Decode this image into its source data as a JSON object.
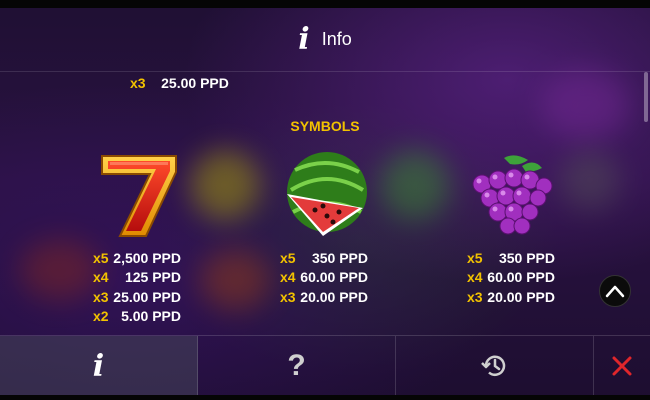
{
  "header": {
    "title": "Info",
    "icon": "info-icon"
  },
  "previous_row": {
    "mult": "x3",
    "value": "25.00 PPD"
  },
  "section_title": "SYMBOLS",
  "symbols": [
    {
      "icon": "seven-icon",
      "pays": [
        {
          "mult": "x5",
          "value": "2,500 PPD"
        },
        {
          "mult": "x4",
          "value": "125 PPD"
        },
        {
          "mult": "x3",
          "value": "25.00 PPD"
        },
        {
          "mult": "x2",
          "value": "5.00 PPD"
        }
      ]
    },
    {
      "icon": "watermelon-icon",
      "pays": [
        {
          "mult": "x5",
          "value": "350 PPD"
        },
        {
          "mult": "x4",
          "value": "60.00 PPD"
        },
        {
          "mult": "x3",
          "value": "20.00 PPD"
        }
      ]
    },
    {
      "icon": "grapes-icon",
      "pays": [
        {
          "mult": "x5",
          "value": "350 PPD"
        },
        {
          "mult": "x4",
          "value": "60.00 PPD"
        },
        {
          "mult": "x3",
          "value": "20.00 PPD"
        }
      ]
    }
  ],
  "tabs": [
    {
      "id": "info",
      "glyph": "i",
      "icon": "info-icon",
      "active": true
    },
    {
      "id": "help",
      "glyph": "?",
      "icon": "question-icon",
      "active": false
    },
    {
      "id": "history",
      "icon": "history-icon",
      "active": false
    },
    {
      "id": "close",
      "icon": "close-icon",
      "active": false
    }
  ],
  "colors": {
    "multiplier": "#f2c200",
    "close": "#e0262b",
    "section_title": "#f2c200"
  }
}
